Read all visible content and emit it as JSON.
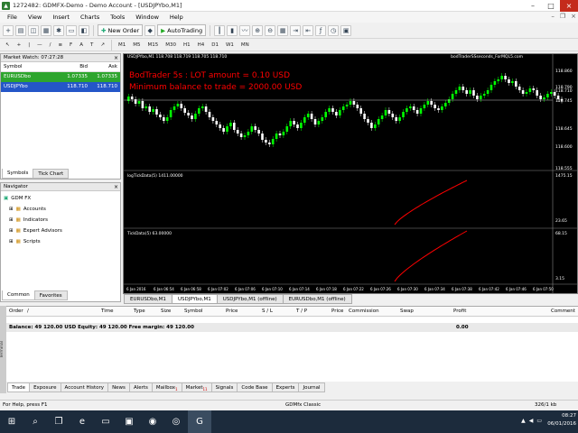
{
  "window": {
    "title": "1272482: GDMFX-Demo - Demo Account - [USDJPYbo,M1]",
    "minimize": "–",
    "maximize": "□",
    "close": "×"
  },
  "menu": [
    "File",
    "View",
    "Insert",
    "Charts",
    "Tools",
    "Window",
    "Help"
  ],
  "toolbar": {
    "new_order": "New Order",
    "autotrading": "AutoTrading"
  },
  "timeframes": [
    "M1",
    "M5",
    "M15",
    "M30",
    "H1",
    "H4",
    "D1",
    "W1",
    "MN"
  ],
  "market_watch": {
    "title": "Market Watch: 07:27:28",
    "col_symbol": "Symbol",
    "col_bid": "Bid",
    "col_ask": "Ask",
    "rows": [
      {
        "symbol": "EURUSDbo",
        "bid": "1.07335",
        "ask": "1.07335",
        "color": "#2ea52e"
      },
      {
        "symbol": "USDJPYbo",
        "bid": "118.710",
        "ask": "118.710",
        "color": "#2456c8"
      }
    ],
    "tabs": [
      "Symbols",
      "Tick Chart"
    ]
  },
  "navigator": {
    "title": "Navigator",
    "root": "GDM FX",
    "items": [
      "Accounts",
      "Indicators",
      "Expert Advisors",
      "Scripts"
    ],
    "tabs": [
      "Common",
      "Favorites"
    ]
  },
  "chart": {
    "header": "USDJPYbo,M1  118.708 118.719 118.705 118.710",
    "ea_name": "bodTraderSSseconds_ForMQL5.com",
    "overlay1": "BodTrader 5s : LOT amount  = 0.10 USD",
    "overlay2": "Minimum balance to trade = 2000.00 USD",
    "price_labels": [
      "118.860",
      "118.790",
      "118.745",
      "118.710",
      "118.645",
      "118.600",
      "118.555"
    ],
    "ind1_label": "logTickData(5) 1411.00000",
    "ind1_ticks": [
      "1475.15",
      "23.65"
    ],
    "ind2_label": "TickData(5) 63.00000",
    "ind2_ticks": [
      "68.15",
      "3.15"
    ],
    "time_labels": [
      "6 Jan 2016",
      "6 Jan 06:54",
      "6 Jan 06:58",
      "6 Jan 07:02",
      "6 Jan 07:06",
      "6 Jan 07:10",
      "6 Jan 07:14",
      "6 Jan 07:18",
      "6 Jan 07:22",
      "6 Jan 07:26",
      "6 Jan 07:30",
      "6 Jan 07:34",
      "6 Jan 07:38",
      "6 Jan 07:42",
      "6 Jan 07:46",
      "6 Jan 07:50"
    ],
    "colors": {
      "bull": "#00ff00",
      "bear": "#ffffff",
      "bid_line": "#c0c0c0",
      "overlay": "#ff0000",
      "indicator": "#ff0000"
    }
  },
  "chart_tabs": [
    "EURUSDbo,M1",
    "USDJPYbo,M1",
    "USDJPYbo,M1 (offline)",
    "EURUSDbo,M1 (offline)"
  ],
  "terminal": {
    "columns": [
      "Order",
      "/",
      "Time",
      "Type",
      "Size",
      "Symbol",
      "Price",
      "S / L",
      "T / P",
      "Price",
      "Commission",
      "Swap",
      "Profit",
      "Comment"
    ],
    "balance_text": "Balance: 49 120.00 USD  Equity: 49 120.00  Free margin: 49 120.00",
    "balance_profit": "0.00",
    "side_label": "Terminal",
    "tabs": [
      "Trade",
      "Exposure",
      "Account History",
      "News",
      "Alerts",
      "Mailbox",
      "Market",
      "Signals",
      "Code Base",
      "Experts",
      "Journal"
    ],
    "mailbox_badge": "1",
    "market_badge": "11"
  },
  "status": {
    "help": "For Help, press F1",
    "profile": "GDMfx Classic",
    "traffic": "326/1 kb"
  },
  "taskbar": {
    "time": "08:27",
    "date": "06/01/2016"
  }
}
